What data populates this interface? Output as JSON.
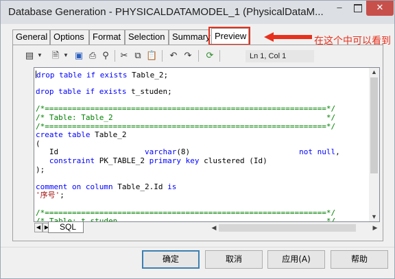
{
  "window": {
    "title": "Database Generation - PHYSICALDATAMODEL_1 (PhysicalDataM...",
    "minimize": "–",
    "close": "✕"
  },
  "tabs": [
    {
      "label": "General"
    },
    {
      "label": "Options"
    },
    {
      "label": "Format"
    },
    {
      "label": "Selection"
    },
    {
      "label": "Summary"
    },
    {
      "label": "Preview",
      "active": true
    }
  ],
  "annotation": {
    "text": "在这个中可以看到源码",
    "color": "#e8301c"
  },
  "toolbar": {
    "icons": [
      "dropdown-list-icon",
      "properties-icon",
      "save-icon",
      "print-icon",
      "find-icon",
      "cut-icon",
      "copy-icon",
      "paste-icon",
      "undo-icon",
      "redo-icon",
      "refresh-icon"
    ],
    "position": "Ln 1, Col 1"
  },
  "editor": {
    "lines": [
      [
        {
          "t": "drop ",
          "c": "kw"
        },
        {
          "t": "table ",
          "c": "kw"
        },
        {
          "t": "if ",
          "c": "kw"
        },
        {
          "t": "exists ",
          "c": "kw"
        },
        {
          "t": "Table_2;",
          "c": ""
        }
      ],
      [],
      [
        {
          "t": "drop ",
          "c": "kw"
        },
        {
          "t": "table ",
          "c": "kw"
        },
        {
          "t": "if ",
          "c": "kw"
        },
        {
          "t": "exists ",
          "c": "kw"
        },
        {
          "t": "t_studen;",
          "c": ""
        }
      ],
      [],
      [
        {
          "t": "/*==============================================================*/",
          "c": "cm"
        }
      ],
      [
        {
          "t": "/* Table: Table_2                                               */",
          "c": "cm"
        }
      ],
      [
        {
          "t": "/*==============================================================*/",
          "c": "cm"
        }
      ],
      [
        {
          "t": "create ",
          "c": "kw"
        },
        {
          "t": "table ",
          "c": "kw"
        },
        {
          "t": "Table_2",
          "c": ""
        }
      ],
      [
        {
          "t": "(",
          "c": ""
        }
      ],
      [
        {
          "t": "   Id                   ",
          "c": ""
        },
        {
          "t": "varchar",
          "c": "kw"
        },
        {
          "t": "(8)                        ",
          "c": ""
        },
        {
          "t": "not null",
          "c": "kw"
        },
        {
          "t": ",",
          "c": ""
        }
      ],
      [
        {
          "t": "   ",
          "c": ""
        },
        {
          "t": "constraint ",
          "c": "kw"
        },
        {
          "t": "PK_TABLE_2 ",
          "c": ""
        },
        {
          "t": "primary key ",
          "c": "kw"
        },
        {
          "t": "clustered (Id)",
          "c": ""
        }
      ],
      [
        {
          "t": ");",
          "c": ""
        }
      ],
      [],
      [
        {
          "t": "comment ",
          "c": "kw"
        },
        {
          "t": "on ",
          "c": "kw"
        },
        {
          "t": "column ",
          "c": "kw"
        },
        {
          "t": "Table_2.Id ",
          "c": ""
        },
        {
          "t": "is",
          "c": "kw"
        }
      ],
      [
        {
          "t": "'序号'",
          "c": "str"
        },
        {
          "t": ";",
          "c": ""
        }
      ],
      [],
      [
        {
          "t": "/*==============================================================*/",
          "c": "cm"
        }
      ],
      [
        {
          "t": "/* Table: t_studen                                              */",
          "c": "cm"
        }
      ]
    ]
  },
  "editor_tab": {
    "label": "SQL"
  },
  "buttons": {
    "ok": "确定",
    "cancel": "取消",
    "apply": "应用(A)",
    "help": "帮助"
  }
}
